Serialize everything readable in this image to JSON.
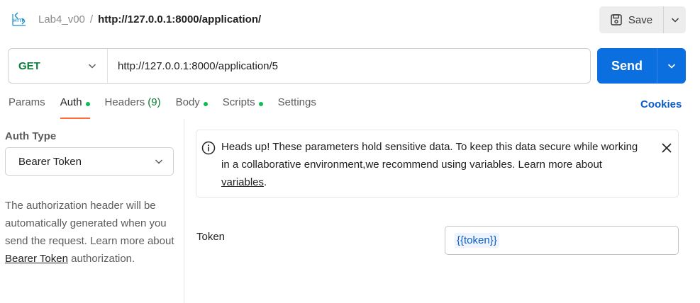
{
  "header": {
    "icon": "http-icon",
    "collection": "Lab4_v00",
    "separator": "/",
    "request_name": "http://127.0.0.1:8000/application/",
    "save_label": "Save"
  },
  "request": {
    "method": "GET",
    "url": "http://127.0.0.1:8000/application/5",
    "send_label": "Send"
  },
  "tabs": [
    {
      "label": "Params"
    },
    {
      "label": "Auth"
    },
    {
      "label": "Headers",
      "count": "(9)"
    },
    {
      "label": "Body"
    },
    {
      "label": "Scripts"
    },
    {
      "label": "Settings"
    }
  ],
  "cookies_label": "Cookies",
  "auth": {
    "type_label": "Auth Type",
    "type_value": "Bearer Token",
    "desc_pre": "The authorization header will be automatically generated when you send the request. Learn more about ",
    "desc_link": "Bearer Token",
    "desc_post": " authorization."
  },
  "alert": {
    "text_pre": "Heads up! These parameters hold sensitive data. To keep this data secure while working in a collaborative environment,we recommend using variables. Learn more about ",
    "link": "variables",
    "text_post": "."
  },
  "token": {
    "label": "Token",
    "value": "{{token}}"
  },
  "colors": {
    "accent_blue": "#0b6fe0",
    "method_green": "#0f7b3a",
    "tab_underline": "#ff6c37",
    "dot_green": "#0cbb52"
  }
}
